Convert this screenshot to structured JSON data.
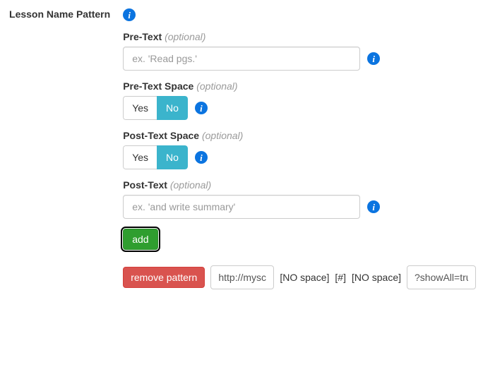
{
  "main_label": "Lesson Name Pattern",
  "pre_text": {
    "label": "Pre-Text",
    "optional": "(optional)",
    "placeholder": "ex. 'Read pgs.'"
  },
  "pre_text_space": {
    "label": "Pre-Text Space",
    "optional": "(optional)",
    "yes": "Yes",
    "no": "No"
  },
  "post_text_space": {
    "label": "Post-Text Space",
    "optional": "(optional)",
    "yes": "Yes",
    "no": "No"
  },
  "post_text": {
    "label": "Post-Text",
    "optional": "(optional)",
    "placeholder": "ex. 'and write summary'"
  },
  "add_button": "add",
  "pattern_row": {
    "remove": "remove pattern",
    "url_value": "http://myschoolyear.com/",
    "no_space_1": "[NO space]",
    "hash": "[#]",
    "no_space_2": "[NO space]",
    "tail_value": "?showAll=true"
  }
}
